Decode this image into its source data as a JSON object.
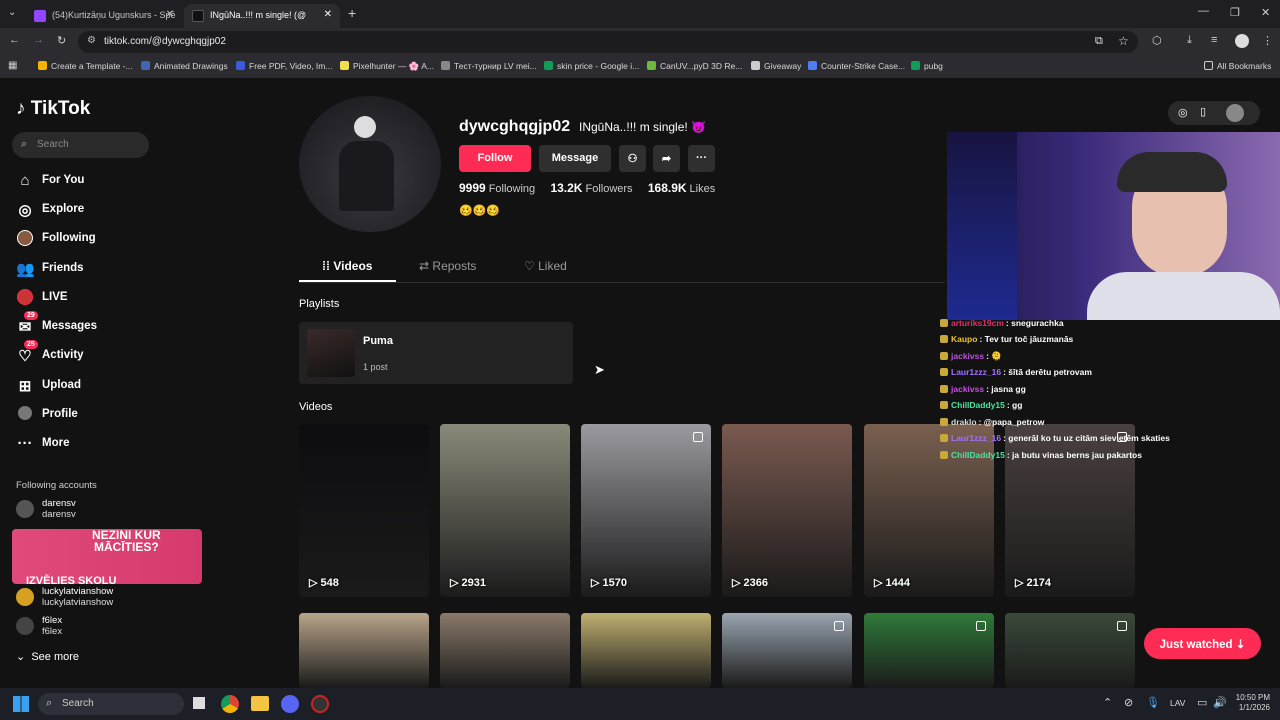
{
  "browser": {
    "tabs": [
      {
        "title": "(54)Kurtizāņu Ugunskurs - Spē",
        "close": "✕",
        "fav_color": "#9146ff"
      },
      {
        "title": "INgūNa..!!! m single! (@",
        "close": "✕",
        "fav_color": "#111111"
      }
    ],
    "new_tab": "+",
    "url": "tiktok.com/@dywcghqgjp02",
    "bookmarks": [
      {
        "label": "Create a Template -...",
        "color": "#f4b400"
      },
      {
        "label": "Animated Drawings",
        "color": "#4267b2"
      },
      {
        "label": "Free PDF, Video, Im...",
        "color": "#3b5bdb"
      },
      {
        "label": "Pixelhunter — 🌸 A...",
        "color": "#f2e04a"
      },
      {
        "label": "Тест-турнир LV mei...",
        "color": "#888888"
      },
      {
        "label": "skin price - Google i...",
        "color": "#0f9d58"
      },
      {
        "label": "CanUV...pyD 3D Re...",
        "color": "#6dbb3c"
      },
      {
        "label": "Giveaway",
        "color": "#cccccc"
      },
      {
        "label": "Counter-Strike Case...",
        "color": "#4f7df0"
      },
      {
        "label": "pubg",
        "color": "#0f9d58"
      }
    ],
    "all_bookmarks": "All Bookmarks"
  },
  "sidebar": {
    "logo": "TikTok",
    "search_placeholder": "Search",
    "nav": [
      {
        "label": "For You",
        "icon": "home-icon"
      },
      {
        "label": "Explore",
        "icon": "compass-icon"
      },
      {
        "label": "Following",
        "icon": "following-avatar-icon"
      },
      {
        "label": "Friends",
        "icon": "friends-icon"
      },
      {
        "label": "LIVE",
        "icon": "live-icon"
      },
      {
        "label": "Messages",
        "icon": "messages-icon",
        "badge": "29"
      },
      {
        "label": "Activity",
        "icon": "activity-icon",
        "badge": "25"
      },
      {
        "label": "Upload",
        "icon": "upload-icon"
      },
      {
        "label": "Profile",
        "icon": "profile-icon"
      },
      {
        "label": "More",
        "icon": "more-icon"
      }
    ],
    "following_header": "Following accounts",
    "accounts": [
      {
        "name": "darensv",
        "handle": "darensv"
      },
      {
        "name": "luckylatvianshow",
        "handle": "luckylatvianshow"
      },
      {
        "name": "f6lex",
        "handle": "f6lex"
      }
    ],
    "ad": {
      "line1": "NEZINI KUR",
      "line2": "MĀCĪTIES?",
      "line3": "IZVĒLIES SKOLU"
    },
    "see_more": "See more"
  },
  "profile": {
    "username": "dywcghqgjp02",
    "nickname": "INgūNa..!!! m single! 😈",
    "follow": "Follow",
    "message": "Message",
    "following_count": "9999",
    "following_label": "Following",
    "followers_count": "13.2K",
    "followers_label": "Followers",
    "likes_count": "168.9K",
    "likes_label": "Likes",
    "bio": "🥴🥴🥴",
    "tabs": [
      "Videos",
      "Reposts",
      "Liked"
    ],
    "playlists_heading": "Playlists",
    "playlist": {
      "name": "Puma",
      "count": "1 post"
    },
    "videos_heading": "Videos",
    "videos": [
      {
        "views": "548",
        "bg": "#0d0d10"
      },
      {
        "views": "2931",
        "bg": "#8a8a7a"
      },
      {
        "views": "1570",
        "bg": "#9a9aa0"
      },
      {
        "views": "2366",
        "bg": "#7a5a50"
      },
      {
        "views": "1444",
        "bg": "#7a6050"
      },
      {
        "views": "2174",
        "bg": "#4a4040"
      },
      {
        "views": "",
        "bg": "#b9a58a"
      },
      {
        "views": "",
        "bg": "#8a7a6a"
      },
      {
        "views": "",
        "bg": "#c0b070"
      },
      {
        "views": "",
        "bg": "#9aa5b0"
      },
      {
        "views": "",
        "bg": "#2f7a3a"
      },
      {
        "views": "",
        "bg": "#3a4a3a"
      }
    ],
    "just_watched": "Just watched ⇣"
  },
  "chat": [
    {
      "user": "arturiks19cm",
      "msg": ": snegurachka",
      "color": "#e0306a"
    },
    {
      "user": "Kaupo",
      "msg": ": Tev tur toč jāuzmanās",
      "color": "#f0c030"
    },
    {
      "user": "jackivss",
      "msg": ": 🫠",
      "color": "#c050e0"
    },
    {
      "user": "Laur1zzz_16",
      "msg": ": šītā derētu petrovam",
      "color": "#a070ff"
    },
    {
      "user": "jackivss",
      "msg": ": jasna gg",
      "color": "#c050e0"
    },
    {
      "user": "ChillDaddy15",
      "msg": ": gg",
      "color": "#50e0a0"
    },
    {
      "user": "draklo",
      "msg": ": @papa_petrow",
      "color": "#d8d8d8"
    },
    {
      "user": "Laur1zzz_16",
      "msg": ": generāl ko tu uz citām sievietēm skaties",
      "color": "#a070ff"
    },
    {
      "user": "ChillDaddy15",
      "msg": ": ja butu vinas berns jau pakartos",
      "color": "#50e0a0"
    }
  ],
  "taskbar": {
    "search": "Search",
    "lang": "LAV",
    "time": "10:50 PM",
    "date": "1/1/2026"
  }
}
